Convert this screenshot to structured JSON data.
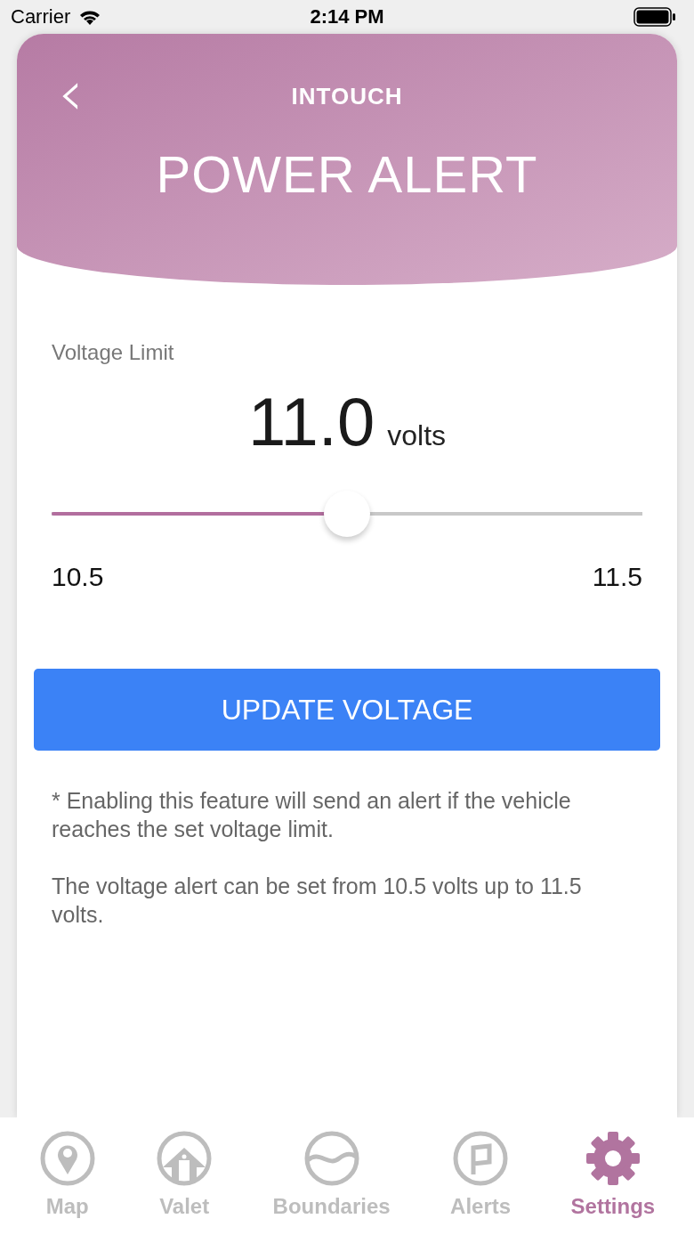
{
  "status_bar": {
    "carrier": "Carrier",
    "time": "2:14 PM"
  },
  "header": {
    "back": "‹",
    "logo": "INTOUCH",
    "title": "POWER ALERT"
  },
  "voltage": {
    "label": "Voltage Limit",
    "value": "11.0",
    "unit": "volts"
  },
  "slider": {
    "level": 0.5,
    "min_label": "10.5",
    "max_label": "11.5"
  },
  "update_button": "UPDATE VOLTAGE",
  "notes": [
    "* Enabling this feature will send an alert if the vehicle reaches the set voltage limit.",
    "The voltage alert can be set from 10.5 volts up to 11.5 volts."
  ],
  "tab_bar": [
    {
      "kind": "map",
      "label": "Map",
      "selected": false
    },
    {
      "kind": "valet",
      "label": "Valet",
      "selected": false
    },
    {
      "kind": "boundaries",
      "label": "Boundaries",
      "selected": false
    },
    {
      "kind": "alerts",
      "label": "Alerts",
      "selected": false
    },
    {
      "kind": "settings",
      "label": "Settings",
      "selected": true
    }
  ]
}
